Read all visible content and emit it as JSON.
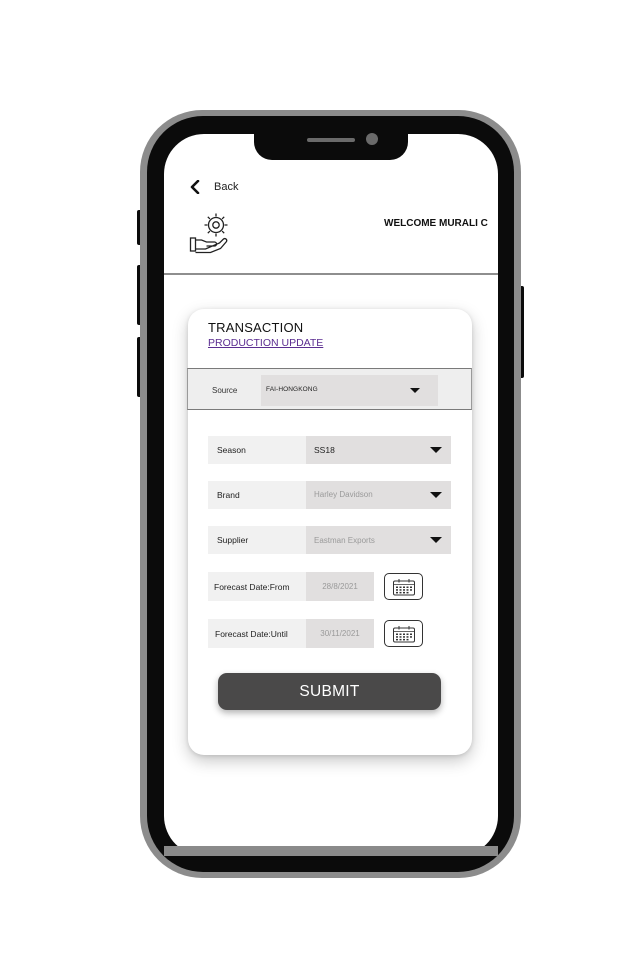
{
  "header": {
    "back_label": "Back",
    "welcome_text": "WELCOME MURALI C",
    "logo_icon": "gear-hand-icon"
  },
  "card": {
    "title": "TRANSACTION",
    "subtitle_link": "PRODUCTION UPDATE"
  },
  "source": {
    "label": "Source",
    "value": "FAI-HONGKONG"
  },
  "form": {
    "season": {
      "label": "Season",
      "value": "SS18"
    },
    "brand": {
      "label": "Brand",
      "value": "Harley Davidson"
    },
    "supplier": {
      "label": "Supplier",
      "value": "Eastman Exports"
    },
    "forecast_from": {
      "label": "Forecast Date:From",
      "value": "28/8/2021"
    },
    "forecast_until": {
      "label": "Forecast Date:Until",
      "value": "30/11/2021"
    }
  },
  "submit_label": "SUBMIT",
  "colors": {
    "link": "#5b2d91",
    "submit_bg": "#4a4949",
    "field_bg": "#e1dfdf",
    "label_bg": "#f1f1f1"
  }
}
